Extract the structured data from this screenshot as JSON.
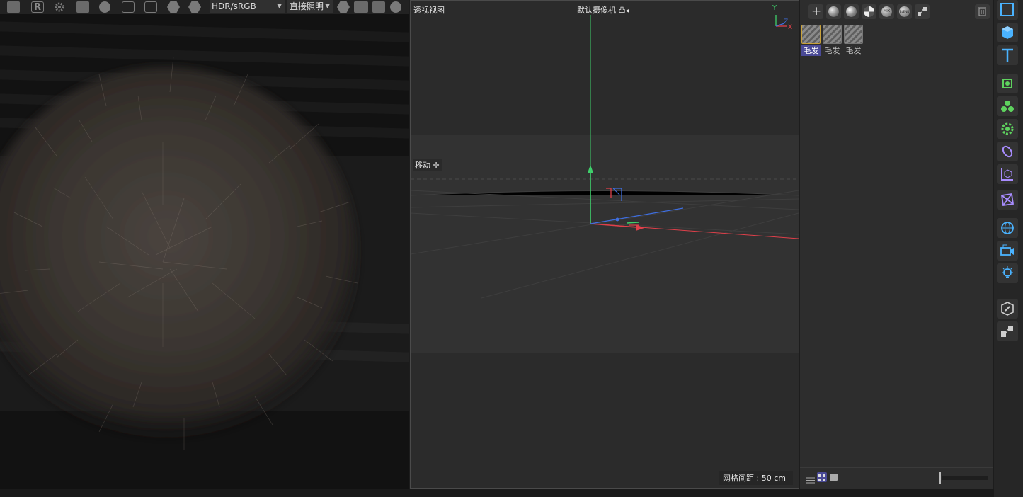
{
  "render_toolbar": {
    "display_mode": "HDR/sRGB",
    "lighting_mode": "直接照明"
  },
  "viewport": {
    "view_name": "透视视图",
    "camera_label": "默认摄像机",
    "tool_label": "移动",
    "grid_spacing": "网格间距 : 50 cm",
    "axis_labels": {
      "y": "Y",
      "z": "Z",
      "x": "X"
    }
  },
  "materials": {
    "items": [
      {
        "name": "毛发",
        "selected": true
      },
      {
        "name": "毛发",
        "selected": false
      },
      {
        "name": "毛发",
        "selected": false
      }
    ]
  },
  "colors": {
    "accent": "#4a4a96",
    "axis_y": "#3fcf6b",
    "axis_x": "#e0404a",
    "axis_z": "#3f6fe0"
  }
}
